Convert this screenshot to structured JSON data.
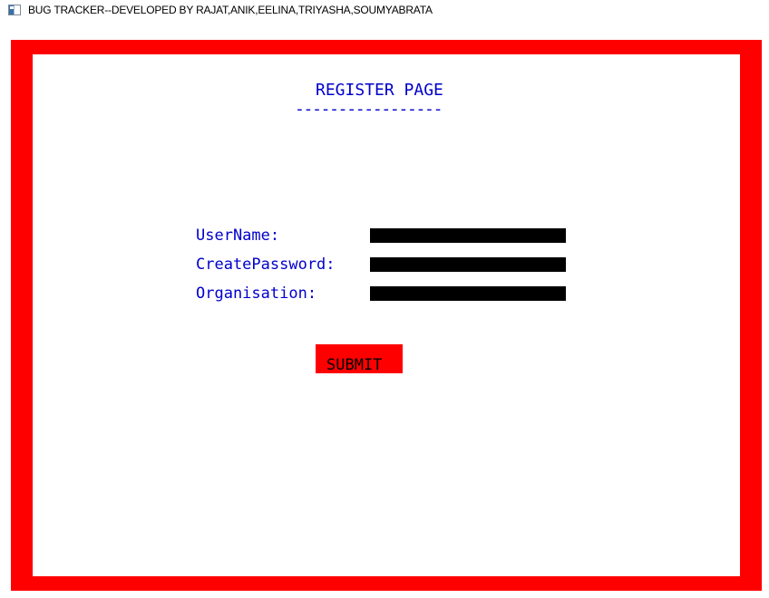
{
  "window": {
    "title": "BUG TRACKER--DEVELOPED BY RAJAT,ANIK,EELINA,TRIYASHA,SOUMYABRATA",
    "icon": "app-window-icon"
  },
  "colors": {
    "frame": "#ff0000",
    "text": "#0000cc",
    "input_fill": "#000000",
    "button_fill": "#ff0000"
  },
  "page": {
    "heading": "REGISTER PAGE",
    "underline": "-----------------"
  },
  "form": {
    "fields": [
      {
        "label": "UserName:",
        "value": ""
      },
      {
        "label": "CreatePassword:",
        "value": ""
      },
      {
        "label": "Organisation:",
        "value": ""
      }
    ],
    "submit_label": "SUBMIT"
  }
}
